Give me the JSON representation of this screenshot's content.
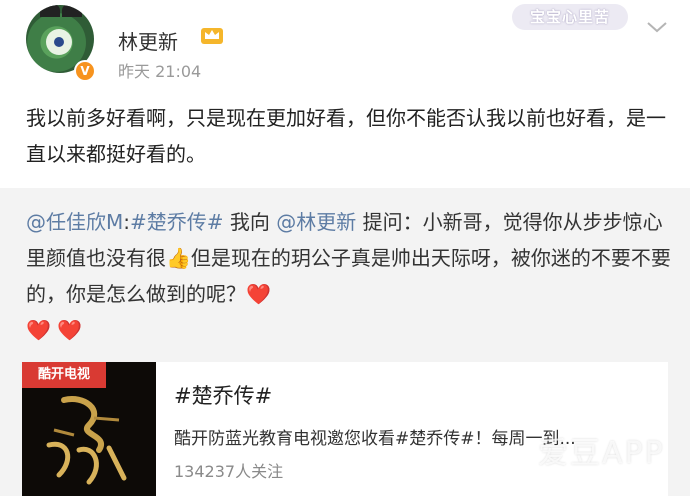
{
  "header": {
    "username": "林更新",
    "post_time": "昨天 21:04",
    "fan_badge": "宝宝心里苦"
  },
  "post": {
    "text": "我以前多好看啊，只是现在更加好看，但你不能否认我以前也好看，是一直以来都挺好看的。"
  },
  "retweet": {
    "author_mention": "@任佳欣M",
    "colon": ":",
    "topic_tag": "#楚乔传#",
    "ask_prefix": " 我向 ",
    "target_mention": "@林更新",
    "body_1": " 提问：小新哥，觉得你从步步惊心里颜值也没有很",
    "body_2": "但是现在的玥公子真是帅出天际呀，被你迷的不要不要的，你是怎么做到的呢？"
  },
  "topic_card": {
    "cover_tag": "酷开电视",
    "title": "#楚乔传#",
    "description": "酷开防蓝光教育电视邀您收看#楚乔传#！每周一到...",
    "followers": "134237人关注"
  },
  "watermark": "爱豆APP",
  "colors": {
    "link": "#5d7ca4",
    "heart": "#e5302f",
    "verified_badge": "#f7931e",
    "retweet_bg": "#f3f3f3"
  },
  "icons": [
    "crown-icon",
    "chevron-down-icon",
    "thumbs-up-icon",
    "heart-icon",
    "verified-icon"
  ]
}
